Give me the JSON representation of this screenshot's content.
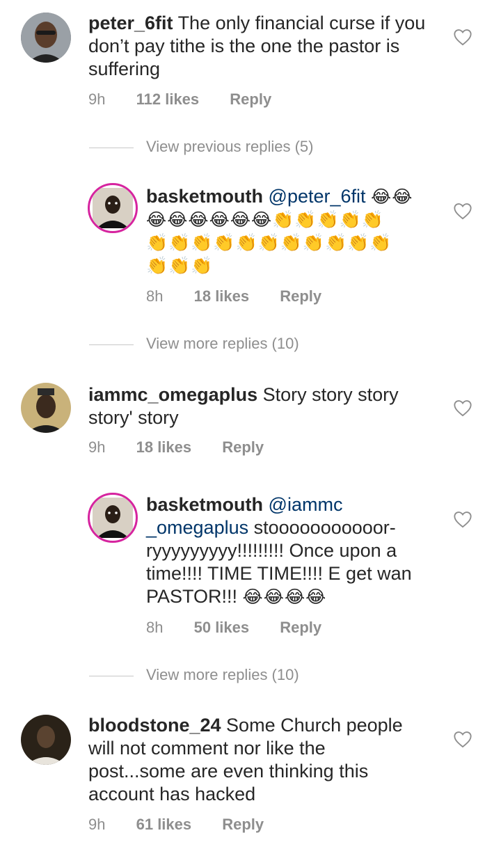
{
  "comments": [
    {
      "username": "peter_6fit",
      "text": "The only financial curse if you don’t pay tithe is the one the pastor is suffering",
      "time": "9h",
      "likes": "112 likes",
      "reply": "Reply"
    },
    {
      "username": "basketmouth",
      "mention": "@peter_6fit",
      "emoji_line1": "😂😂",
      "emoji_line2": "😂😂😂😂😂😂👏👏👏👏👏",
      "emoji_line3": "👏👏👏👏👏👏👏👏👏👏👏",
      "emoji_line4": "👏👏👏",
      "time": "8h",
      "likes": "18 likes",
      "reply": "Reply"
    },
    {
      "username": "iammc_omegaplus",
      "text": "Story story story story' story",
      "time": "9h",
      "likes": "18 likes",
      "reply": "Reply"
    },
    {
      "username": "basketmouth",
      "mention_line1": "@iammc",
      "mention_line2": "_omegaplus",
      "text1": " stooooooooooor-",
      "text2": "ryyyyyyyyy!!!!!!!!! Once upon a",
      "text3": "time!!!! TIME TIME!!!! E get wan",
      "text4": "PASTOR!!! ",
      "emoji": "😂😂😂😂",
      "time": "8h",
      "likes": "50 likes",
      "reply": "Reply"
    },
    {
      "username": "bloodstone_24",
      "text": "Some Church people will not comment nor like the post...some are even thinking this account has hacked",
      "time": "9h",
      "likes": "61 likes",
      "reply": "Reply"
    }
  ],
  "view_previous": "View previous replies (5)",
  "view_more_1": "View more replies (10)",
  "view_more_2": "View more replies (10)",
  "colors": {
    "mention": "#003569",
    "meta": "#8e8e8e",
    "story_ring": "#d6249f"
  },
  "icons": {
    "like": "heart-outline-icon"
  }
}
